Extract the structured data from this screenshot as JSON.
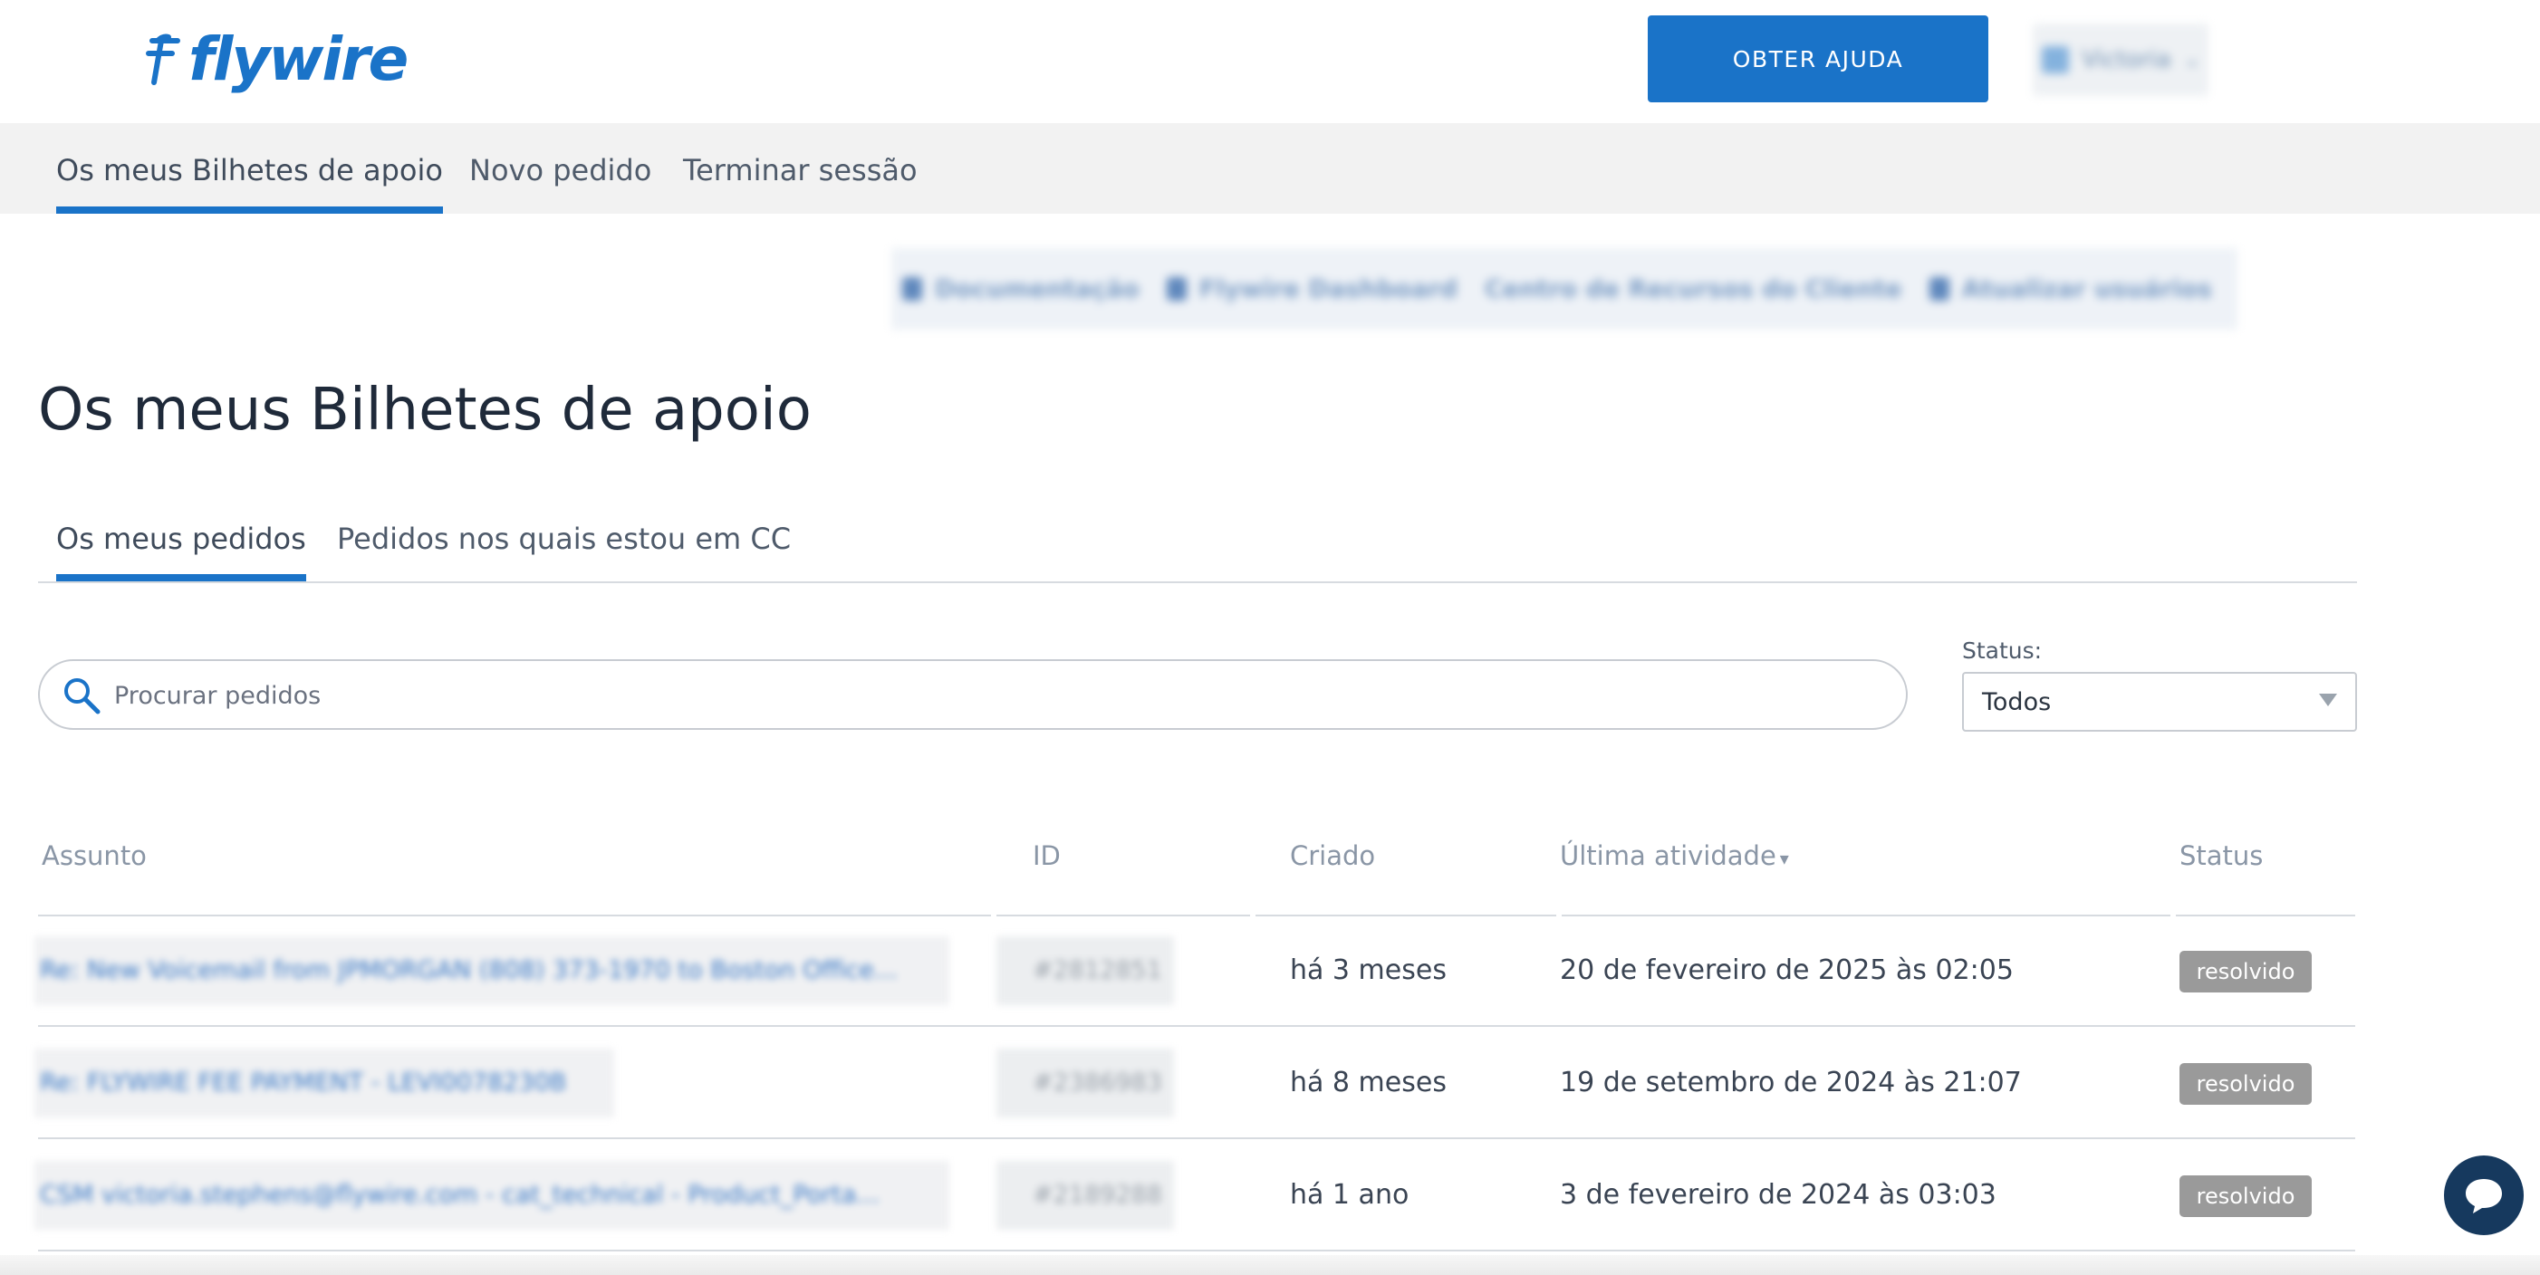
{
  "header": {
    "logo": "flywire",
    "help_button": "OBTER AJUDA",
    "user_name": "Victoria"
  },
  "nav": {
    "tabs": [
      "Os meus Bilhetes de apoio",
      "Novo pedido",
      "Terminar sessão"
    ],
    "active": "Os meus Bilhetes de apoio"
  },
  "quick_links": [
    "Documentação",
    "Flywire Dashboard",
    "Centro de Recursos do Cliente",
    "Atualizar usuários"
  ],
  "page_title": "Os meus Bilhetes de apoio",
  "subtabs": [
    "Os meus pedidos",
    "Pedidos nos quais estou em CC"
  ],
  "search": {
    "placeholder": "Procurar pedidos"
  },
  "status_filter": {
    "label": "Status:",
    "value": "Todos"
  },
  "table": {
    "columns": [
      "Assunto",
      "ID",
      "Criado",
      "Última atividade",
      "Status"
    ],
    "rows": [
      {
        "subject": "Re: New Voicemail from JPMORGAN (808) 373-1970 to Boston Office...",
        "id": "#2812851",
        "created": "há 3 meses",
        "last_activity": "20 de fevereiro de 2025 às 02:05",
        "status": "resolvido"
      },
      {
        "subject": "Re: FLYWIRE FEE PAYMENT - LEVI0078230B",
        "id": "#2386983",
        "created": "há 8 meses",
        "last_activity": "19 de setembro de 2024 às 21:07",
        "status": "resolvido"
      },
      {
        "subject": "CSM victoria.stephens@flywire.com - cat_technical - Product_Porta...",
        "id": "#2189288",
        "created": "há 1 ano",
        "last_activity": "3 de fevereiro de 2024 às 03:03",
        "status": "resolvido"
      }
    ]
  },
  "colors": {
    "accent": "#1a73c8",
    "badge": "#9a9a9a",
    "chat": "#16395e"
  },
  "icons": {
    "search": "search-icon",
    "chat": "chat-icon",
    "lock": "lock-icon"
  }
}
